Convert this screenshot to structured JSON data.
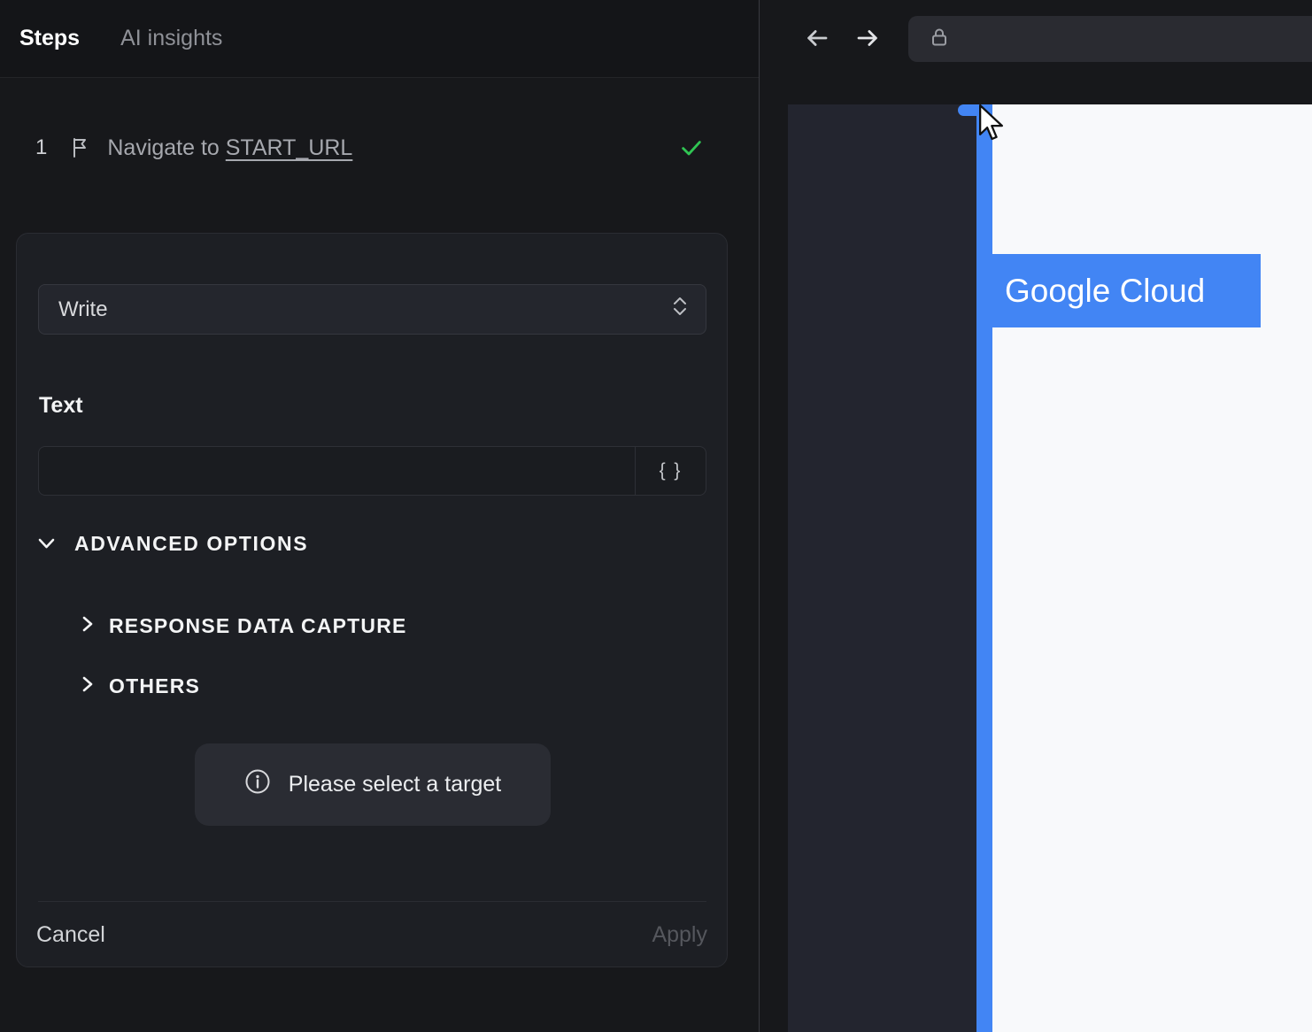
{
  "left_panel": {
    "tabs": [
      {
        "label": "Steps",
        "active": true
      },
      {
        "label": "AI insights",
        "active": false
      }
    ],
    "step": {
      "number": "1",
      "title_prefix": "Navigate to ",
      "title_link": "START_URL",
      "status": "success"
    },
    "editor": {
      "action_select": {
        "value": "Write"
      },
      "text_label": "Text",
      "text_input": {
        "value": "",
        "placeholder": ""
      },
      "braces_button_label": "{ }",
      "advanced_options_label": "ADVANCED OPTIONS",
      "sections": [
        {
          "label": "RESPONSE DATA CAPTURE"
        },
        {
          "label": "OTHERS"
        }
      ],
      "target_hint": "Please select a target",
      "cancel_label": "Cancel",
      "apply_label": "Apply"
    }
  },
  "browser": {
    "url_value": "",
    "page_overlay_label": "Google Cloud"
  },
  "colors": {
    "accent_blue": "#4285f4",
    "success_green": "#30c553",
    "panel_bg": "#17181b",
    "card_bg": "#1d1f24"
  }
}
